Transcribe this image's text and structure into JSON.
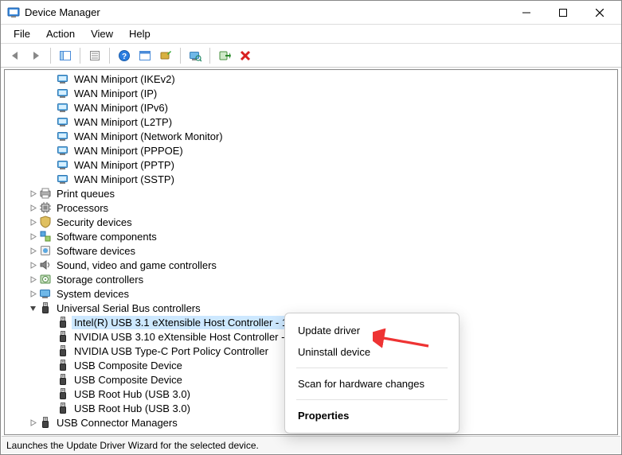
{
  "window": {
    "title": "Device Manager"
  },
  "menubar": [
    "File",
    "Action",
    "View",
    "Help"
  ],
  "statusbar": "Launches the Update Driver Wizard for the selected device.",
  "context_menu": {
    "items": [
      {
        "label": "Update driver",
        "type": "item"
      },
      {
        "label": "Uninstall device",
        "type": "item"
      },
      {
        "type": "sep"
      },
      {
        "label": "Scan for hardware changes",
        "type": "item"
      },
      {
        "type": "sep"
      },
      {
        "label": "Properties",
        "type": "item",
        "bold": true
      }
    ]
  },
  "toolbar": {
    "back": "back-icon",
    "forward": "forward-icon",
    "show_hide": "panes-icon",
    "properties": "properties-icon",
    "help": "help-icon",
    "action_menu": "action-menu-icon",
    "update": "update-driver-icon",
    "scan": "scan-hardware-icon",
    "uninstall": "uninstall-icon",
    "delete": "delete-icon"
  },
  "tree": [
    {
      "indent": 2,
      "icon": "network-adapter",
      "label": "WAN Miniport (IKEv2)",
      "leaf": true
    },
    {
      "indent": 2,
      "icon": "network-adapter",
      "label": "WAN Miniport (IP)",
      "leaf": true
    },
    {
      "indent": 2,
      "icon": "network-adapter",
      "label": "WAN Miniport (IPv6)",
      "leaf": true
    },
    {
      "indent": 2,
      "icon": "network-adapter",
      "label": "WAN Miniport (L2TP)",
      "leaf": true
    },
    {
      "indent": 2,
      "icon": "network-adapter",
      "label": "WAN Miniport (Network Monitor)",
      "leaf": true
    },
    {
      "indent": 2,
      "icon": "network-adapter",
      "label": "WAN Miniport (PPPOE)",
      "leaf": true
    },
    {
      "indent": 2,
      "icon": "network-adapter",
      "label": "WAN Miniport (PPTP)",
      "leaf": true
    },
    {
      "indent": 2,
      "icon": "network-adapter",
      "label": "WAN Miniport (SSTP)",
      "leaf": true
    },
    {
      "indent": 1,
      "icon": "print-queue",
      "label": "Print queues",
      "collapsed": true
    },
    {
      "indent": 1,
      "icon": "processor",
      "label": "Processors",
      "collapsed": true
    },
    {
      "indent": 1,
      "icon": "security",
      "label": "Security devices",
      "collapsed": true
    },
    {
      "indent": 1,
      "icon": "software-comp",
      "label": "Software components",
      "collapsed": true
    },
    {
      "indent": 1,
      "icon": "software-dev",
      "label": "Software devices",
      "collapsed": true
    },
    {
      "indent": 1,
      "icon": "sound",
      "label": "Sound, video and game controllers",
      "collapsed": true
    },
    {
      "indent": 1,
      "icon": "storage",
      "label": "Storage controllers",
      "collapsed": true
    },
    {
      "indent": 1,
      "icon": "system",
      "label": "System devices",
      "collapsed": true
    },
    {
      "indent": 1,
      "icon": "usb-controller",
      "label": "Universal Serial Bus controllers",
      "expanded": true
    },
    {
      "indent": 2,
      "icon": "usb-device",
      "label": "Intel(R) USB 3.1 eXtensible Host Controller - 1.10",
      "leaf": true,
      "selected": true
    },
    {
      "indent": 2,
      "icon": "usb-device",
      "label": "NVIDIA USB 3.10 eXtensible Host Controller - 1.1",
      "leaf": true
    },
    {
      "indent": 2,
      "icon": "usb-device",
      "label": "NVIDIA USB Type-C Port Policy Controller",
      "leaf": true
    },
    {
      "indent": 2,
      "icon": "usb-device",
      "label": "USB Composite Device",
      "leaf": true
    },
    {
      "indent": 2,
      "icon": "usb-device",
      "label": "USB Composite Device",
      "leaf": true
    },
    {
      "indent": 2,
      "icon": "usb-device",
      "label": "USB Root Hub (USB 3.0)",
      "leaf": true
    },
    {
      "indent": 2,
      "icon": "usb-device",
      "label": "USB Root Hub (USB 3.0)",
      "leaf": true
    },
    {
      "indent": 1,
      "icon": "usb-connector",
      "label": "USB Connector Managers",
      "collapsed": true
    }
  ]
}
